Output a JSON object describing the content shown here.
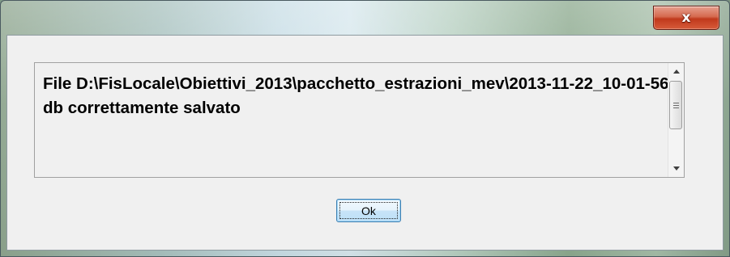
{
  "window": {
    "close_glyph": "x",
    "close_color": "#c7432a",
    "frame_style": "aero-glass"
  },
  "message": {
    "text": "File D:\\FisLocale\\Obiettivi_2013\\pacchetto_estrazioni_mev\\2013-11-22_10-01-56.db correttamente salvato"
  },
  "scrollbar": {
    "up_icon": "scroll-up-arrow",
    "down_icon": "scroll-down-arrow",
    "thumb_icon": "grip-lines"
  },
  "buttons": {
    "ok_label": "Ok",
    "ok_border_color": "#3c7fb1"
  }
}
